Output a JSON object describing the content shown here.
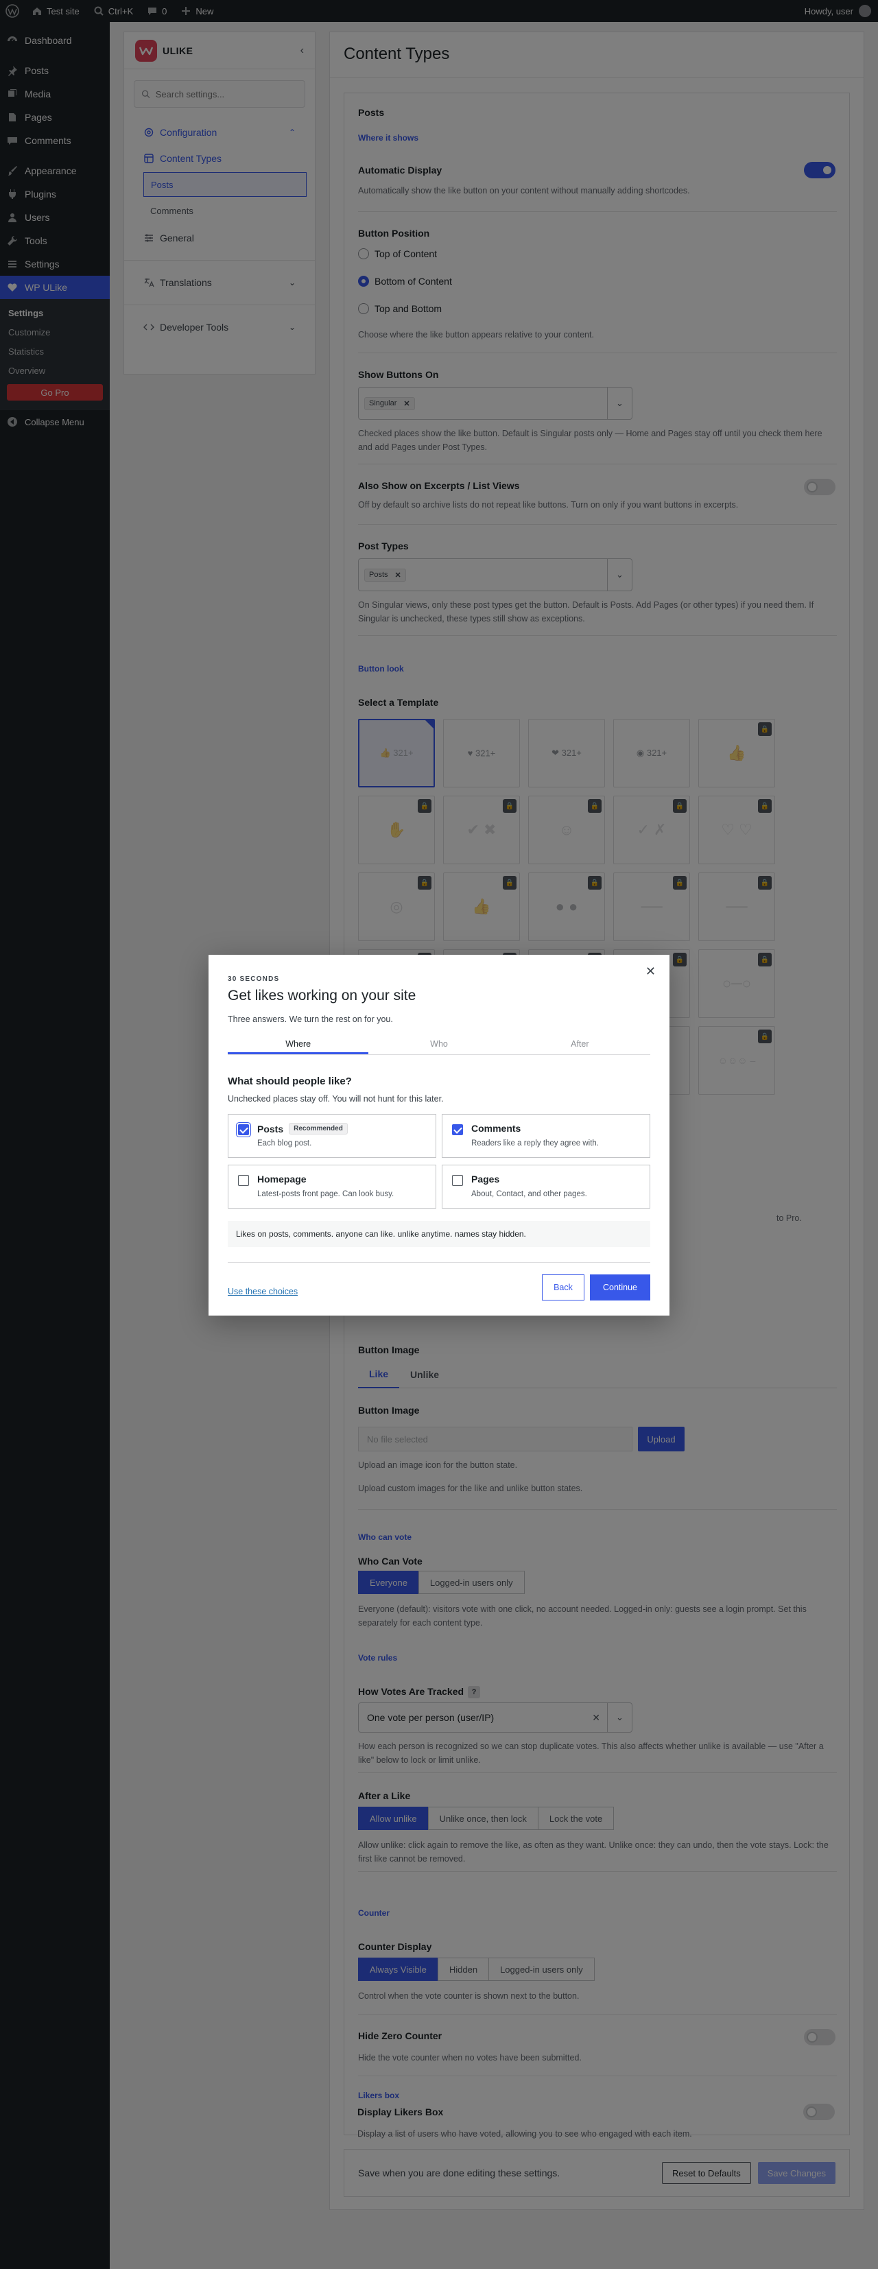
{
  "adminbar": {
    "site": "Test site",
    "search": "Ctrl+K",
    "comments": "0",
    "new": "New",
    "howdy": "Howdy, user"
  },
  "sidebar": {
    "items": [
      {
        "label": "Dashboard",
        "icon": "dashboard-icon"
      },
      {
        "label": "Posts",
        "icon": "pin-icon"
      },
      {
        "label": "Media",
        "icon": "media-icon"
      },
      {
        "label": "Pages",
        "icon": "pages-icon"
      },
      {
        "label": "Comments",
        "icon": "comment-icon"
      },
      {
        "label": "Appearance",
        "icon": "brush-icon"
      },
      {
        "label": "Plugins",
        "icon": "plug-icon"
      },
      {
        "label": "Users",
        "icon": "user-icon"
      },
      {
        "label": "Tools",
        "icon": "wrench-icon"
      },
      {
        "label": "Settings",
        "icon": "settings-icon"
      },
      {
        "label": "WP ULike",
        "icon": "heart-icon"
      }
    ],
    "submenu": [
      "Settings",
      "Customize",
      "Statistics",
      "Overview"
    ],
    "gopro": "Go Pro",
    "collapse": "Collapse Menu",
    "accent": "#3858e9"
  },
  "nav": {
    "brand": "ULIKE",
    "search_placeholder": "Search settings...",
    "configuration": "Configuration",
    "content_types": "Content Types",
    "posts": "Posts",
    "comments": "Comments",
    "general": "General",
    "translations": "Translations",
    "developer_tools": "Developer Tools"
  },
  "main": {
    "title": "Content Types",
    "panel_title": "Posts",
    "where_it_shows": "Where it shows",
    "auto_display_label": "Automatic Display",
    "auto_display_desc": "Automatically show the like button on your content without manually adding shortcodes.",
    "auto_display_on": true,
    "button_position_label": "Button Position",
    "positions": [
      "Top of Content",
      "Bottom of Content",
      "Top and Bottom"
    ],
    "position_selected": "Bottom of Content",
    "button_position_desc": "Choose where the like button appears relative to your content.",
    "show_on_label": "Show Buttons On",
    "show_on_chip": "Singular",
    "show_on_desc": "Checked places show the like button. Default is Singular posts only — Home and Pages stay off until you check them here and add Pages under Post Types.",
    "excerpts_label": "Also Show on Excerpts / List Views",
    "excerpts_desc": "Off by default so archive lists do not repeat like buttons. Turn on only if you want buttons in excerpts.",
    "post_types_label": "Post Types",
    "post_types_chip": "Posts",
    "post_types_desc": "On Singular views, only these post types get the button. Default is Posts. Add Pages (or other types) if you need them. If Singular is unchecked, these types still show as exceptions.",
    "button_look": "Button look",
    "template_label": "Select a Template",
    "template_values": [
      "321+",
      "321+",
      "321+",
      "321+"
    ],
    "pro_note": "to Pro.",
    "button_image_label": "Button Image",
    "image_tabs": [
      "Like",
      "Unlike"
    ],
    "button_image_sub": "Button Image",
    "file_placeholder": "No file selected",
    "upload": "Upload",
    "upload_desc": "Upload an image icon for the button state.",
    "upload_desc2": "Upload custom images for the like and unlike button states.",
    "who_can_vote_section": "Who can vote",
    "who_can_vote_label": "Who Can Vote",
    "who_options": [
      "Everyone",
      "Logged-in users only"
    ],
    "who_desc": "Everyone (default): visitors vote with one click, no account needed. Logged-in only: guests see a login prompt. Set this separately for each content type.",
    "vote_rules": "Vote rules",
    "tracked_label": "How Votes Are Tracked",
    "tracked_help": "?",
    "tracked_value": "One vote per person (user/IP)",
    "tracked_desc": "How each person is recognized so we can stop duplicate votes. This also affects whether unlike is available — use \"After a like\" below to lock or limit unlike.",
    "after_like_label": "After a Like",
    "after_options": [
      "Allow unlike",
      "Unlike once, then lock",
      "Lock the vote"
    ],
    "after_desc": "Allow unlike: click again to remove the like, as often as they want. Unlike once: they can undo, then the vote stays. Lock: the first like cannot be removed.",
    "counter": "Counter",
    "counter_display_label": "Counter Display",
    "counter_options": [
      "Always Visible",
      "Hidden",
      "Logged-in users only"
    ],
    "counter_desc": "Control when the vote counter is shown next to the button.",
    "hide_zero_label": "Hide Zero Counter",
    "hide_zero_desc": "Hide the vote counter when no votes have been submitted.",
    "likers_box": "Likers box",
    "display_likers_label": "Display Likers Box",
    "display_likers_desc": "Display a list of users who have voted, allowing you to see who engaged with each item.",
    "save_text": "Save when you are done editing these settings.",
    "reset": "Reset to Defaults",
    "save": "Save Changes"
  },
  "modal": {
    "eyebrow": "30 SECONDS",
    "title": "Get likes working on your site",
    "subtitle": "Three answers. We turn the rest on for you.",
    "steps": [
      "Where",
      "Who",
      "After"
    ],
    "question": "What should people like?",
    "hint": "Unchecked places stay off. You will not hunt for this later.",
    "options": [
      {
        "label": "Posts",
        "badge": "Recommended",
        "desc": "Each blog post.",
        "checked": true
      },
      {
        "label": "Comments",
        "badge": "",
        "desc": "Readers like a reply they agree with.",
        "checked": true
      },
      {
        "label": "Homepage",
        "badge": "",
        "desc": "Latest-posts front page. Can look busy.",
        "checked": false
      },
      {
        "label": "Pages",
        "badge": "",
        "desc": "About, Contact, and other pages.",
        "checked": false
      }
    ],
    "summary": "Likes on posts, comments. anyone can like. unlike anytime. names stay hidden.",
    "use_choices": "Use these choices",
    "back": "Back",
    "continue": "Continue"
  }
}
